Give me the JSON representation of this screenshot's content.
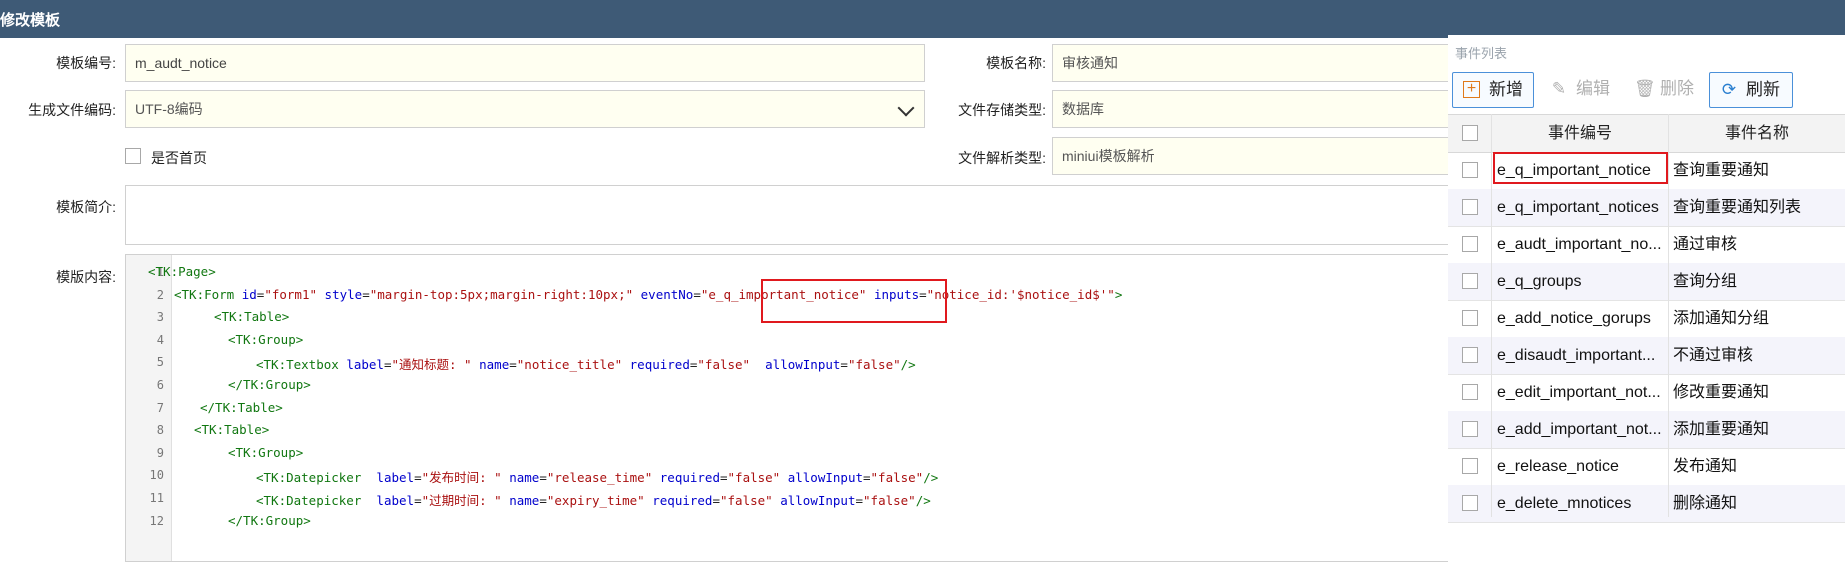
{
  "window": {
    "title": "修改模板"
  },
  "form": {
    "template_no_label": "模板编号:",
    "template_no_value": "m_audt_notice",
    "template_name_label": "模板名称:",
    "template_name_value": "审核通知",
    "encoding_label": "生成文件编码:",
    "encoding_value": "UTF-8编码",
    "storage_label": "文件存储类型:",
    "storage_value": "数据库",
    "homepage_label": "是否首页",
    "parse_label": "文件解析类型:",
    "parse_value": "miniui模板解析",
    "intro_label": "模板简介:",
    "content_label": "模版内容:"
  },
  "code": {
    "line_numbers": [
      "1",
      "2",
      "3",
      "4",
      "5",
      "6",
      "7",
      "8",
      "9",
      "10",
      "11",
      "12"
    ],
    "lines": [
      [
        {
          "t": "tag",
          "v": "<TK:Page>"
        }
      ],
      [
        {
          "t": "tag",
          "v": "<TK:Form "
        },
        {
          "t": "attr",
          "v": "id"
        },
        {
          "t": "plain",
          "v": "="
        },
        {
          "t": "str",
          "v": "\"form1\""
        },
        {
          "t": "plain",
          "v": " "
        },
        {
          "t": "attr",
          "v": "style"
        },
        {
          "t": "plain",
          "v": "="
        },
        {
          "t": "str",
          "v": "\"margin-top:5px;margin-right:10px;\""
        },
        {
          "t": "plain",
          "v": " "
        },
        {
          "t": "attr",
          "v": "eventNo"
        },
        {
          "t": "plain",
          "v": "="
        },
        {
          "t": "str",
          "v": "\"e_q_important_notice\""
        },
        {
          "t": "plain",
          "v": " "
        },
        {
          "t": "attr",
          "v": "inputs"
        },
        {
          "t": "plain",
          "v": "="
        },
        {
          "t": "str",
          "v": "\"notice_id:'$notice_id$'\""
        },
        {
          "t": "tag",
          "v": ">"
        }
      ],
      [
        {
          "t": "tag",
          "v": "<TK:Table>"
        }
      ],
      [
        {
          "t": "tag",
          "v": "<TK:Group>"
        }
      ],
      [
        {
          "t": "tag",
          "v": "<TK:Textbox "
        },
        {
          "t": "attr",
          "v": "label"
        },
        {
          "t": "plain",
          "v": "="
        },
        {
          "t": "str",
          "v": "\"通知标题: \""
        },
        {
          "t": "plain",
          "v": " "
        },
        {
          "t": "attr",
          "v": "name"
        },
        {
          "t": "plain",
          "v": "="
        },
        {
          "t": "str",
          "v": "\"notice_title\""
        },
        {
          "t": "plain",
          "v": " "
        },
        {
          "t": "attr",
          "v": "required"
        },
        {
          "t": "plain",
          "v": "="
        },
        {
          "t": "str",
          "v": "\"false\""
        },
        {
          "t": "plain",
          "v": "  "
        },
        {
          "t": "attr",
          "v": "allowInput"
        },
        {
          "t": "plain",
          "v": "="
        },
        {
          "t": "str",
          "v": "\"false\""
        },
        {
          "t": "tag",
          "v": "/>"
        }
      ],
      [
        {
          "t": "tag",
          "v": "</TK:Group>"
        }
      ],
      [
        {
          "t": "tag",
          "v": "</TK:Table>"
        }
      ],
      [
        {
          "t": "tag",
          "v": "<TK:Table>"
        }
      ],
      [
        {
          "t": "tag",
          "v": "<TK:Group>"
        }
      ],
      [
        {
          "t": "tag",
          "v": "<TK:Datepicker  "
        },
        {
          "t": "attr",
          "v": "label"
        },
        {
          "t": "plain",
          "v": "="
        },
        {
          "t": "str",
          "v": "\"发布时间: \""
        },
        {
          "t": "plain",
          "v": " "
        },
        {
          "t": "attr",
          "v": "name"
        },
        {
          "t": "plain",
          "v": "="
        },
        {
          "t": "str",
          "v": "\"release_time\""
        },
        {
          "t": "plain",
          "v": " "
        },
        {
          "t": "attr",
          "v": "required"
        },
        {
          "t": "plain",
          "v": "="
        },
        {
          "t": "str",
          "v": "\"false\""
        },
        {
          "t": "plain",
          "v": " "
        },
        {
          "t": "attr",
          "v": "allowInput"
        },
        {
          "t": "plain",
          "v": "="
        },
        {
          "t": "str",
          "v": "\"false\""
        },
        {
          "t": "tag",
          "v": "/>"
        }
      ],
      [
        {
          "t": "tag",
          "v": "<TK:Datepicker  "
        },
        {
          "t": "attr",
          "v": "label"
        },
        {
          "t": "plain",
          "v": "="
        },
        {
          "t": "str",
          "v": "\"过期时间: \""
        },
        {
          "t": "plain",
          "v": " "
        },
        {
          "t": "attr",
          "v": "name"
        },
        {
          "t": "plain",
          "v": "="
        },
        {
          "t": "str",
          "v": "\"expiry_time\""
        },
        {
          "t": "plain",
          "v": " "
        },
        {
          "t": "attr",
          "v": "required"
        },
        {
          "t": "plain",
          "v": "="
        },
        {
          "t": "str",
          "v": "\"false\""
        },
        {
          "t": "plain",
          "v": " "
        },
        {
          "t": "attr",
          "v": "allowInput"
        },
        {
          "t": "plain",
          "v": "="
        },
        {
          "t": "str",
          "v": "\"false\""
        },
        {
          "t": "tag",
          "v": "/>"
        }
      ],
      [
        {
          "t": "tag",
          "v": "</TK:Group>"
        }
      ]
    ]
  },
  "events": {
    "panel_title": "事件列表",
    "toolbar": {
      "add": "新增",
      "edit": "编辑",
      "delete": "删除",
      "refresh": "刷新"
    },
    "columns": {
      "no": "事件编号",
      "name": "事件名称"
    },
    "rows": [
      {
        "no": "e_q_important_notice",
        "name": "查询重要通知"
      },
      {
        "no": "e_q_important_notices",
        "name": "查询重要通知列表"
      },
      {
        "no": "e_audt_important_no...",
        "name": "通过审核"
      },
      {
        "no": "e_q_groups",
        "name": "查询分组"
      },
      {
        "no": "e_add_notice_gorups",
        "name": "添加通知分组"
      },
      {
        "no": "e_disaudt_important...",
        "name": "不通过审核"
      },
      {
        "no": "e_edit_important_not...",
        "name": "修改重要通知"
      },
      {
        "no": "e_add_important_not...",
        "name": "添加重要通知"
      },
      {
        "no": "e_release_notice",
        "name": "发布通知"
      },
      {
        "no": "e_delete_mnotices",
        "name": "删除通知"
      }
    ]
  },
  "colors": {
    "titlebar": "#3e5a76",
    "highlight": "#e0191e",
    "field_bg": "#fffff1"
  }
}
